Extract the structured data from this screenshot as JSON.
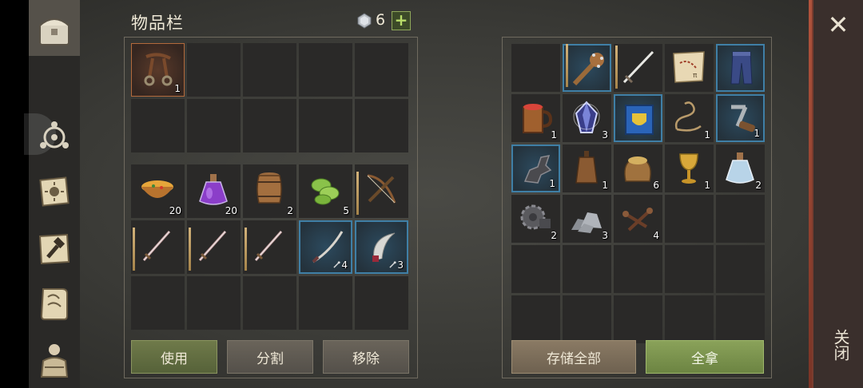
{
  "header": {
    "title": "物品栏",
    "gem_count": "6",
    "plus_label": "+"
  },
  "sidebar": {
    "items": [
      "chest-icon",
      "compass-icon",
      "sun-book-icon",
      "hammer-map-icon",
      "scroll-icon",
      "character-icon"
    ]
  },
  "inventory": {
    "equip_grid": [
      {
        "icon": "leather-harness",
        "count": "1",
        "style": "sel-orange"
      },
      {},
      {},
      {},
      {},
      {},
      {},
      {},
      {},
      {}
    ],
    "bag_grid": [
      {
        "icon": "soup-bowl",
        "count": "20"
      },
      {
        "icon": "purple-potion",
        "count": "20"
      },
      {
        "icon": "barrel",
        "count": "2"
      },
      {
        "icon": "green-cabbage",
        "count": "5"
      },
      {
        "icon": "crossbow",
        "count": "",
        "dur": true
      },
      {
        "icon": "sword",
        "count": "",
        "dur": true
      },
      {
        "icon": "sword",
        "count": "",
        "dur": true
      },
      {
        "icon": "sword",
        "count": "",
        "dur": true
      },
      {
        "icon": "katana",
        "count": "4",
        "style": "blue",
        "repair": true
      },
      {
        "icon": "scythe-blade",
        "count": "3",
        "style": "blue",
        "repair": true
      },
      {},
      {},
      {},
      {},
      {}
    ]
  },
  "storage": {
    "grid": [
      {},
      {
        "icon": "spiked-club",
        "count": "",
        "style": "blue",
        "dur": true
      },
      {
        "icon": "long-sword",
        "count": "",
        "dur": true
      },
      {
        "icon": "treasure-map",
        "count": ""
      },
      {
        "icon": "blue-pants",
        "count": "",
        "style": "blue"
      },
      {
        "icon": "beer-mug",
        "count": "1"
      },
      {
        "icon": "crystal",
        "count": "3"
      },
      {
        "icon": "blue-book",
        "count": "",
        "style": "blue"
      },
      {
        "icon": "rope",
        "count": "1"
      },
      {
        "icon": "crank-handle",
        "count": "1",
        "style": "blue"
      },
      {
        "icon": "dark-part",
        "count": "1",
        "style": "blue"
      },
      {
        "icon": "leather-flask",
        "count": "1"
      },
      {
        "icon": "grain-sack",
        "count": "6"
      },
      {
        "icon": "golden-goblet",
        "count": "1"
      },
      {
        "icon": "water-potion",
        "count": "2"
      },
      {
        "icon": "gear",
        "count": "2"
      },
      {
        "icon": "stones",
        "count": "3"
      },
      {
        "icon": "nails",
        "count": "4"
      },
      {},
      {},
      {},
      {},
      {},
      {},
      {},
      {},
      {},
      {},
      {},
      {}
    ]
  },
  "buttons": {
    "use": "使用",
    "split": "分割",
    "remove": "移除",
    "store_all": "存储全部",
    "take_all": "全拿"
  },
  "close": {
    "label": "关闭",
    "x": "✕"
  },
  "colors": {
    "accent_green": "#8aa25a",
    "blue_frame": "#3f7fa6",
    "selected_orange": "#b36a3c"
  }
}
